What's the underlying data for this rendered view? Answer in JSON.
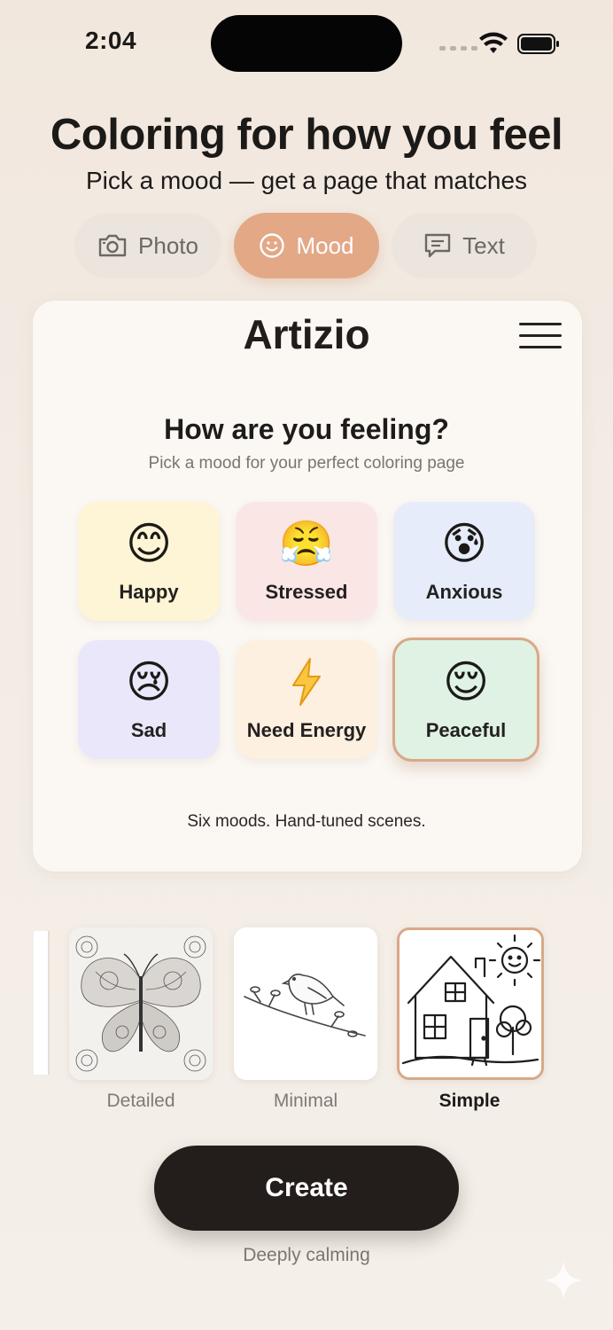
{
  "status_bar": {
    "time": "2:04"
  },
  "header": {
    "title": "Coloring for how you feel",
    "subtitle": "Pick a mood — get a page that matches"
  },
  "tabs": [
    {
      "label": "Photo",
      "icon": "camera-icon",
      "active": false
    },
    {
      "label": "Mood",
      "icon": "smiley-icon",
      "active": true
    },
    {
      "label": "Text",
      "icon": "chat-icon",
      "active": false
    }
  ],
  "card": {
    "brand": "Artizio",
    "question": "How are you feeling?",
    "hint": "Pick a mood for your perfect coloring page",
    "moods": [
      {
        "label": "Happy",
        "emoji": "😊",
        "icon": "smiling-face-icon"
      },
      {
        "label": "Stressed",
        "emoji": "😤",
        "icon": "steaming-face-icon"
      },
      {
        "label": "Anxious",
        "emoji": "😰",
        "icon": "anxious-face-icon"
      },
      {
        "label": "Sad",
        "emoji": "😢",
        "icon": "crying-face-icon"
      },
      {
        "label": "Need Energy",
        "emoji": "⚡",
        "icon": "lightning-icon"
      },
      {
        "label": "Peaceful",
        "emoji": "😌",
        "icon": "relieved-face-icon",
        "selected": true
      }
    ],
    "tagline": "Six moods. Hand-tuned scenes."
  },
  "styles": [
    {
      "label": "Detailed",
      "icon": "butterfly-mandala-thumbnail",
      "selected": false
    },
    {
      "label": "Minimal",
      "icon": "bird-branch-thumbnail",
      "selected": false
    },
    {
      "label": "Simple",
      "icon": "house-sun-thumbnail",
      "selected": true
    }
  ],
  "create_button": {
    "label": "Create"
  },
  "footnote": "Deeply calming",
  "colors": {
    "accent": "#e3a886",
    "selected_border": "#d9a888",
    "button": "#231e1b",
    "background": "#f3ece5"
  }
}
